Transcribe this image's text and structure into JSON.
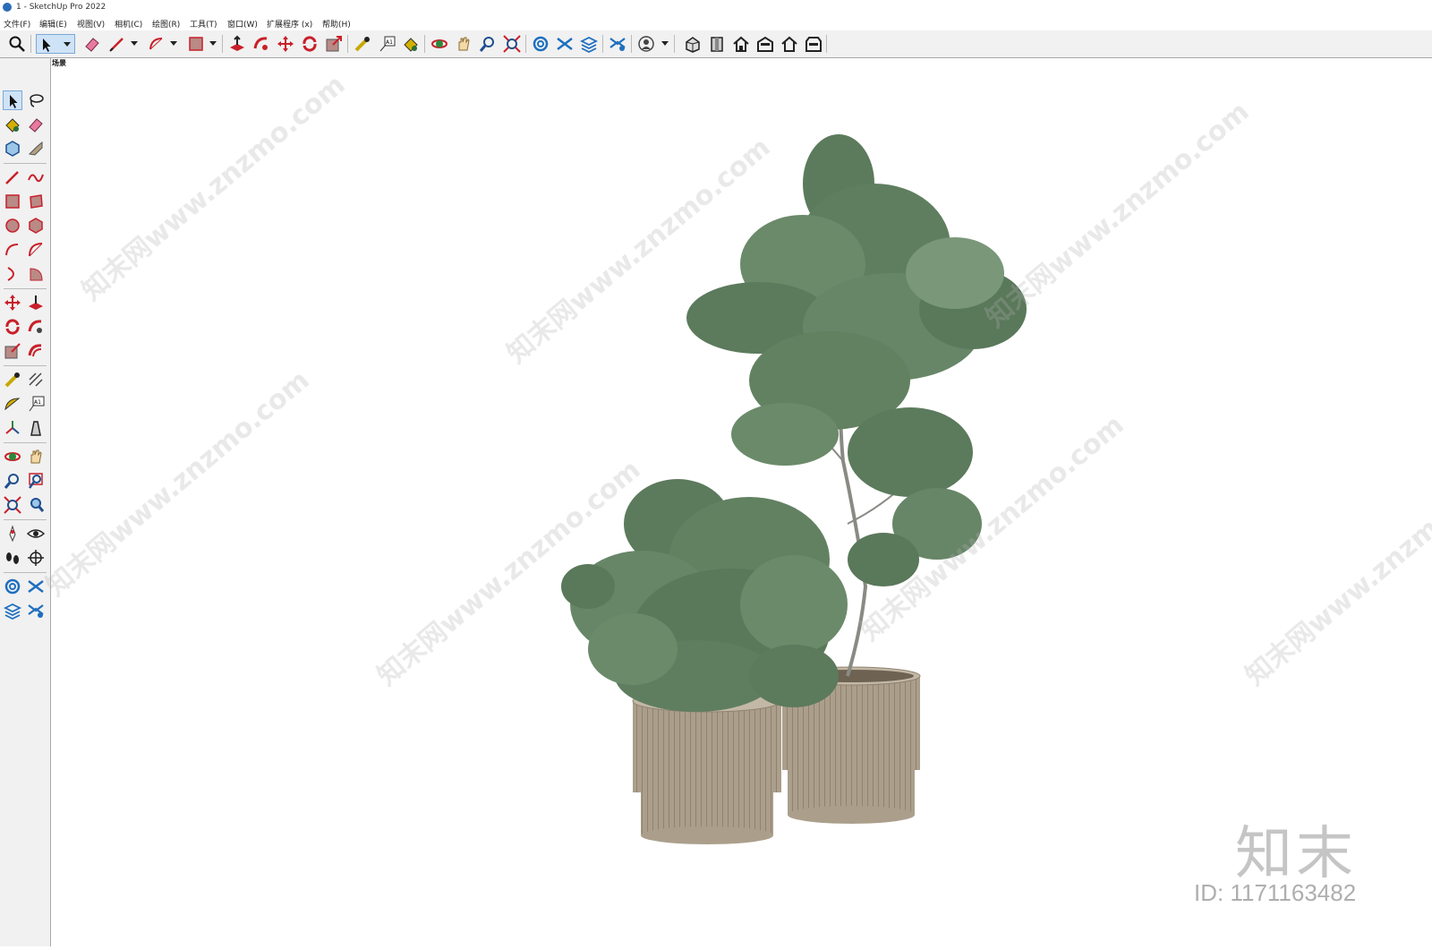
{
  "window": {
    "title": "1 - SketchUp Pro 2022"
  },
  "menu": {
    "items": [
      "文件(F)",
      "编辑(E)",
      "视图(V)",
      "相机(C)",
      "绘图(R)",
      "工具(T)",
      "窗口(W)",
      "扩展程序 (x)",
      "帮助(H)"
    ]
  },
  "scene": {
    "tab_label": "场景"
  },
  "watermark": {
    "text": "知末网www.znzmo.com",
    "brand": "知末",
    "id": "ID: 1171163482"
  },
  "colors": {
    "toolbar_bg": "#f1f1f1",
    "selection": "#cfe3f7",
    "accent_red": "#c8202a",
    "accent_blue": "#1e6fbf",
    "pot": "#ab9f8c",
    "foliage": "#5c7a5c"
  },
  "toolbar_icons": [
    "zoom-icon",
    "select-icon",
    "eraser-icon",
    "pencil-icon",
    "arc-icon",
    "rectangle-icon",
    "push-pull-icon",
    "follow-me-icon",
    "move-icon",
    "rotate-icon",
    "scale-icon",
    "tape-measure-icon",
    "text-icon",
    "paint-bucket-icon",
    "orbit-icon",
    "pan-icon",
    "zoom-tool-icon",
    "zoom-extents-icon",
    "warehouse-icon",
    "extension-warehouse-icon",
    "layout-icon",
    "extension-manager-icon",
    "account-icon",
    "iso-view-icon",
    "top-view-icon",
    "front-view-icon",
    "right-view-icon",
    "back-view-icon",
    "left-view-icon"
  ]
}
